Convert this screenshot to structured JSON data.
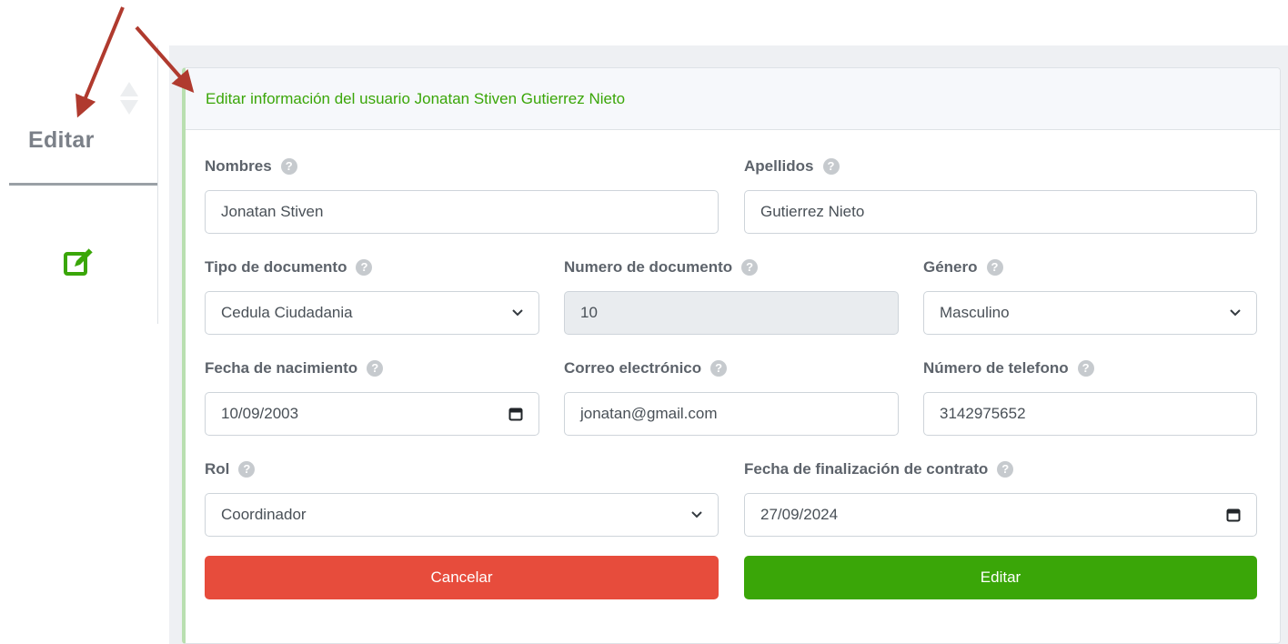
{
  "table": {
    "column_header": "Editar",
    "row_action_icon": "edit-square-icon",
    "sort_icon": "sort-icon"
  },
  "form": {
    "title": "Editar información del usuario Jonatan Stiven Gutierrez Nieto",
    "help_glyph": "?",
    "fields": {
      "nombres": {
        "label": "Nombres",
        "value": "Jonatan Stiven"
      },
      "apellidos": {
        "label": "Apellidos",
        "value": "Gutierrez Nieto"
      },
      "tipo_documento": {
        "label": "Tipo de documento",
        "value": "Cedula Ciudadania"
      },
      "numero_documento": {
        "label": "Numero de documento",
        "value": "10"
      },
      "genero": {
        "label": "Género",
        "value": "Masculino"
      },
      "fecha_nacimiento": {
        "label": "Fecha de nacimiento",
        "value": "10/09/2003"
      },
      "correo": {
        "label": "Correo electrónico",
        "value": "jonatan@gmail.com"
      },
      "telefono": {
        "label": "Número de telefono",
        "value": "3142975652"
      },
      "rol": {
        "label": "Rol",
        "value": "Coordinador"
      },
      "fecha_fin_contrato": {
        "label": "Fecha de finalización de contrato",
        "value": "27/09/2024"
      }
    },
    "buttons": {
      "cancel": "Cancelar",
      "submit": "Editar"
    }
  },
  "colors": {
    "accent_green": "#3aa608",
    "danger_red": "#e74c3c",
    "annotation_arrow": "#b03a2e"
  }
}
